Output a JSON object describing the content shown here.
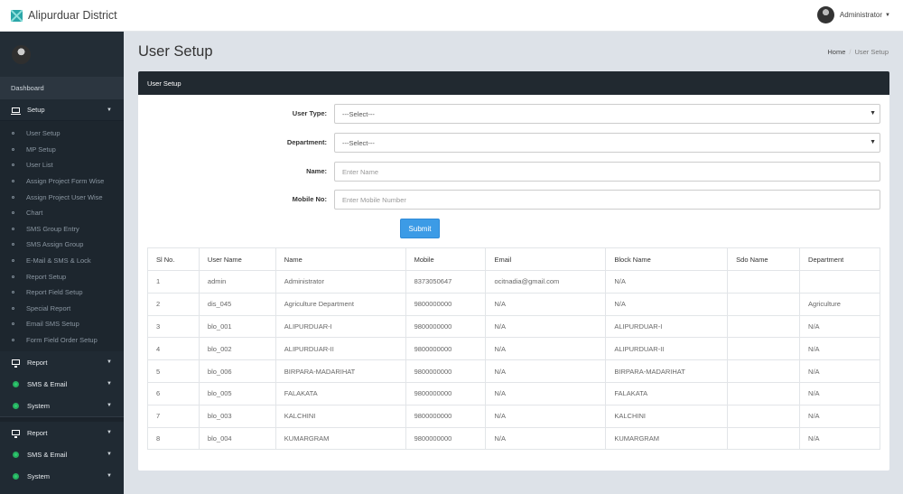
{
  "brand": {
    "name": "Alipurduar District"
  },
  "user": {
    "name": "Administrator"
  },
  "sidebar": {
    "dashboard": "Dashboard",
    "setup": "Setup",
    "setup_items": [
      "User Setup",
      "MP Setup",
      "User List",
      "Assign Project Form Wise",
      "Assign Project User Wise",
      "Chart",
      "SMS Group Entry",
      "SMS Assign Group",
      "E-Mail & SMS & Lock",
      "Report Setup",
      "Report Field Setup",
      "Special Report",
      "Email SMS Setup",
      "Form Field Order Setup"
    ],
    "group1": [
      "Report",
      "SMS & Email",
      "System"
    ],
    "group2": [
      "Report",
      "SMS & Email",
      "System"
    ]
  },
  "page": {
    "title": "User Setup",
    "breadcrumb_home": "Home",
    "breadcrumb_current": "User Setup",
    "panel_title": "User Setup"
  },
  "form": {
    "user_type_label": "User Type:",
    "user_type_value": "---Select---",
    "department_label": "Department:",
    "department_value": "---Select---",
    "name_label": "Name:",
    "name_placeholder": "Enter Name",
    "mobile_label": "Mobile No:",
    "mobile_placeholder": "Enter Mobile Number",
    "submit_label": "Submit"
  },
  "table": {
    "headers": [
      "Sl No.",
      "User Name",
      "Name",
      "Mobile",
      "Email",
      "Block Name",
      "Sdo Name",
      "Department"
    ],
    "rows": [
      [
        "1",
        "admin",
        "Administrator",
        "8373050647",
        "ocitnadia@gmail.com",
        "N/A",
        "",
        ""
      ],
      [
        "2",
        "dis_045",
        "Agriculture Department",
        "9800000000",
        "N/A",
        "N/A",
        "",
        "Agriculture"
      ],
      [
        "3",
        "blo_001",
        "ALIPURDUAR-I",
        "9800000000",
        "N/A",
        "ALIPURDUAR-I",
        "",
        "N/A"
      ],
      [
        "4",
        "blo_002",
        "ALIPURDUAR-II",
        "9800000000",
        "N/A",
        "ALIPURDUAR-II",
        "",
        "N/A"
      ],
      [
        "5",
        "blo_006",
        "BIRPARA-MADARIHAT",
        "9800000000",
        "N/A",
        "BIRPARA-MADARIHAT",
        "",
        "N/A"
      ],
      [
        "6",
        "blo_005",
        "FALAKATA",
        "9800000000",
        "N/A",
        "FALAKATA",
        "",
        "N/A"
      ],
      [
        "7",
        "blo_003",
        "KALCHINI",
        "9800000000",
        "N/A",
        "KALCHINI",
        "",
        "N/A"
      ],
      [
        "8",
        "blo_004",
        "KUMARGRAM",
        "9800000000",
        "N/A",
        "KUMARGRAM",
        "",
        "N/A"
      ]
    ]
  }
}
